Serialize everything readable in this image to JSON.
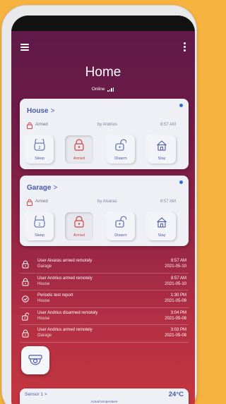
{
  "header": {
    "title": "Home",
    "status": "Online"
  },
  "house": {
    "name": "House",
    "chevron": ">",
    "state": "Armed",
    "by": "by Andrius",
    "time": "8:57 AM",
    "modes": [
      "Sleep",
      "Armed",
      "Disarm",
      "Stay"
    ]
  },
  "garage": {
    "name": "Garage",
    "chevron": ">",
    "state": "Armed",
    "by": "by Aivaras",
    "time": "8:57 AM",
    "modes": [
      "Sleep",
      "Armed",
      "Disarm",
      "Stay"
    ]
  },
  "events": [
    {
      "icon": "lock-icon",
      "title": "User Aivaras armed remotely",
      "sub": "Garage",
      "time": "8:57 AM",
      "date": "2021-05-10"
    },
    {
      "icon": "lock-icon",
      "title": "User Andrius armed remotely",
      "sub": "House",
      "time": "8:57 AM",
      "date": "2021-05-10"
    },
    {
      "icon": "test-report-icon",
      "title": "Periodic test report",
      "sub": "House",
      "time": "1:30 PM",
      "date": "2021-05-09"
    },
    {
      "icon": "unlock-icon",
      "title": "User Andrius disarmed remotely",
      "sub": "House",
      "time": "3:04 PM",
      "date": "2021-05-08"
    },
    {
      "icon": "lock-icon",
      "title": "User Andrius armed remotely",
      "sub": "Garage",
      "time": "3:03 PM",
      "date": "2021-05-08"
    }
  ],
  "sensor": {
    "name": "Sensor 1 >",
    "value": "24°C",
    "subtitle": "Actual temperature"
  },
  "colors": {
    "accent": "#4a5aa8",
    "armed_red": "#d04040",
    "background": "#f6b33f"
  }
}
